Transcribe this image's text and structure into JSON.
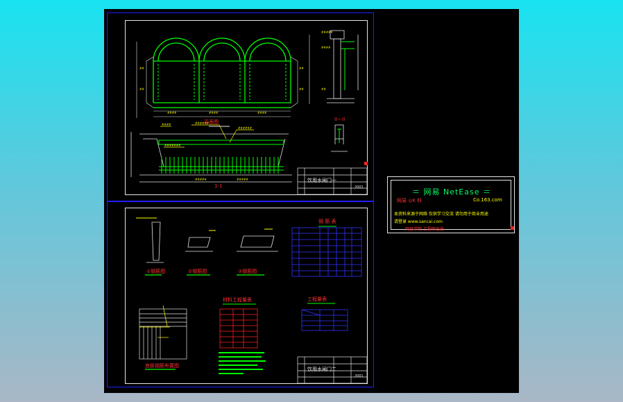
{
  "sheet1": {
    "plan_label": "平面图",
    "section_label": "1-1",
    "section_label_2": "II－II",
    "title_block": {
      "title": "饮用水闸门一",
      "code": "2001"
    }
  },
  "sheet2": {
    "table1_title": "钢 筋 表",
    "table2_title": "材料工程量表",
    "table3_title": "工程量表",
    "detail1_label": "①钢筋图",
    "detail2_label": "②钢筋图",
    "detail3_label": "③钢筋图",
    "detail4_label": "底板钢筋布置图",
    "title_block": {
      "title": "饮用水闸门二",
      "code": "2001"
    }
  },
  "netease": {
    "title": "＝ 网易 NetEase ＝",
    "line1_left": "网易 ◎K 科",
    "line1_right": "Co.163.com",
    "line2": "本资料来源于网络 仅供学习交流 请勿用于商业用途",
    "line3": "请登录 www.sancai.com",
    "line4": "网易学院 工程师在线"
  },
  "colors": {
    "background_top": "#19e3f0",
    "canvas": "#000000",
    "frame": "#2020ff",
    "structure": "#00ff00",
    "annotation": "#ffff00",
    "dimension": "#00ffff",
    "highlight": "#ff2020",
    "table": "#3333ff"
  }
}
